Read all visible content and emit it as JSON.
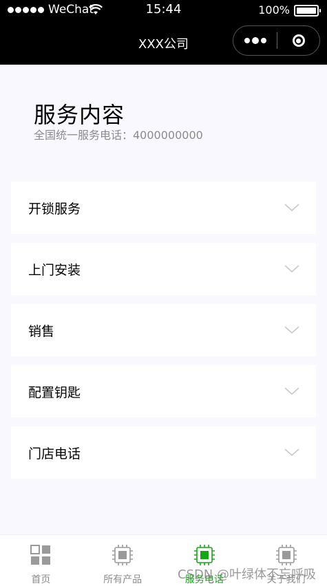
{
  "status_bar": {
    "carrier": "WeChat",
    "time": "15:44",
    "battery": "100%"
  },
  "nav": {
    "title": "XXX公司"
  },
  "page": {
    "title": "服务内容",
    "subtitle": "全国统一服务电话：4000000000"
  },
  "services": [
    {
      "label": "开锁服务"
    },
    {
      "label": "上门安装"
    },
    {
      "label": "销售"
    },
    {
      "label": "配置钥匙"
    },
    {
      "label": "门店电话"
    }
  ],
  "tabs": [
    {
      "label": "首页",
      "icon": "grid-icon",
      "active": false
    },
    {
      "label": "所有产品",
      "icon": "chip-icon",
      "active": false
    },
    {
      "label": "服务电话",
      "icon": "chip-icon",
      "active": true
    },
    {
      "label": "关于我们",
      "icon": "chip-icon",
      "active": false
    }
  ],
  "watermark": "CSDN @叶绿体不忘呼吸",
  "colors": {
    "header_bg": "#000000",
    "page_bg": "#f9f8fe",
    "active_tab": "#13a813",
    "inactive_tab": "#8d8d8d"
  }
}
